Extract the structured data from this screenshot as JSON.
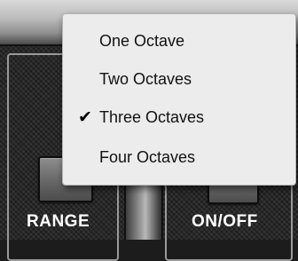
{
  "menu": {
    "items": [
      {
        "label": "One Octave",
        "checked": false
      },
      {
        "label": "Two Octaves",
        "checked": false
      },
      {
        "label": "Three Octaves",
        "checked": true
      },
      {
        "label": "Four Octaves",
        "checked": false
      }
    ],
    "check_glyph": "✔"
  },
  "controls": {
    "range_label": "RANGE",
    "onoff_label": "ON/OFF"
  }
}
